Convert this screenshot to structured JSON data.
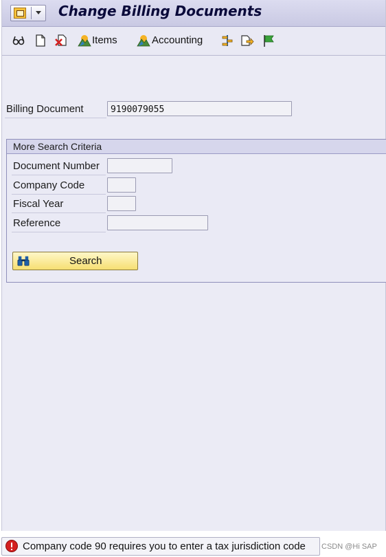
{
  "window": {
    "title": "Change Billing Documents"
  },
  "toolbar": {
    "items": [
      {
        "icon": "glasses-display-icon"
      },
      {
        "icon": "new-document-icon"
      },
      {
        "icon": "cancel-document-icon"
      },
      {
        "icon": "mountain-items-icon",
        "label": "Items"
      },
      {
        "icon": "mountain-accounting-icon",
        "label": "Accounting"
      },
      {
        "icon": "settings-tree-icon"
      },
      {
        "icon": "copy-forward-icon"
      },
      {
        "icon": "green-flag-icon"
      }
    ]
  },
  "main": {
    "billing_document": {
      "label": "Billing Document",
      "value": "9190079055"
    }
  },
  "search_group": {
    "title": "More Search Criteria",
    "fields": [
      {
        "label": "Document Number",
        "value": ""
      },
      {
        "label": "Company Code",
        "value": ""
      },
      {
        "label": "Fiscal Year",
        "value": ""
      },
      {
        "label": "Reference",
        "value": ""
      }
    ],
    "search_button": {
      "label": "Search",
      "icon": "binoculars-icon"
    }
  },
  "status_bar": {
    "type": "error",
    "icon": "error-icon",
    "message": "Company code 90 requires you to enter a tax jurisdiction code"
  },
  "watermark": "CSDN @Hi SAP",
  "colors": {
    "accent": "#f6df72",
    "error": "#d42020",
    "background": "#ebebf5"
  }
}
